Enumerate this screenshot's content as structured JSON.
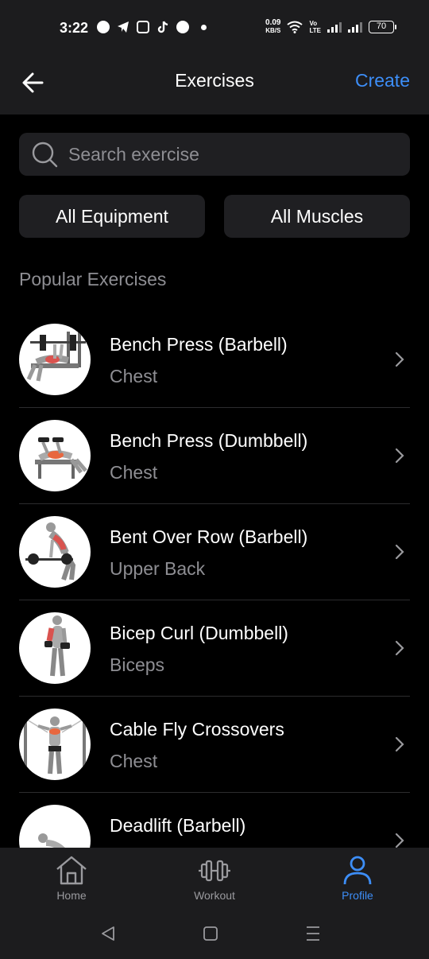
{
  "status_bar": {
    "time": "3:22",
    "net_speed_value": "0.09",
    "net_speed_unit": "KB/S",
    "lte_top": "Vo",
    "lte_bottom": "LTE",
    "battery": "70"
  },
  "header": {
    "title": "Exercises",
    "create_label": "Create"
  },
  "search": {
    "placeholder": "Search exercise"
  },
  "filters": {
    "equipment_label": "All Equipment",
    "muscles_label": "All Muscles"
  },
  "section_title": "Popular Exercises",
  "exercises": [
    {
      "name": "Bench Press (Barbell)",
      "muscle": "Chest"
    },
    {
      "name": "Bench Press (Dumbbell)",
      "muscle": "Chest"
    },
    {
      "name": "Bent Over Row (Barbell)",
      "muscle": "Upper Back"
    },
    {
      "name": "Bicep Curl (Dumbbell)",
      "muscle": "Biceps"
    },
    {
      "name": "Cable Fly Crossovers",
      "muscle": "Chest"
    },
    {
      "name": "Deadlift (Barbell)",
      "muscle": ""
    }
  ],
  "bottom_nav": {
    "home_label": "Home",
    "workout_label": "Workout",
    "profile_label": "Profile"
  },
  "colors": {
    "accent": "#3d8ef8",
    "background": "#000000",
    "surface": "#1c1c1e",
    "secondary_text": "#8e8e93"
  }
}
